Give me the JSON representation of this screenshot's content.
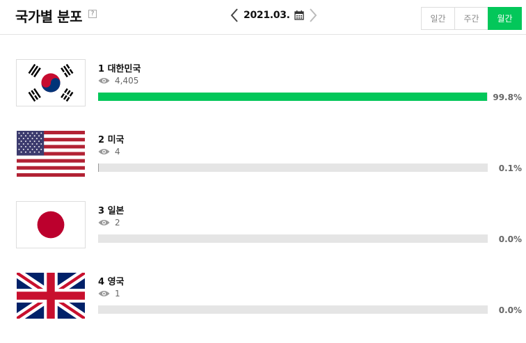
{
  "header": {
    "title": "국가별 분포",
    "help_label": "?",
    "date": "2021.03.",
    "period_tabs": [
      {
        "label": "일간",
        "active": false
      },
      {
        "label": "주간",
        "active": false
      },
      {
        "label": "월간",
        "active": true
      }
    ]
  },
  "colors": {
    "accent": "#03c75a",
    "track": "#e5e5e5",
    "secondary_bar": "#999999"
  },
  "countries": [
    {
      "rank_name": "1 대한민국",
      "views": "4,405",
      "percent_label": "99.8%",
      "share": 0.998,
      "flag_icon": "flag-korea-icon"
    },
    {
      "rank_name": "2 미국",
      "views": "4",
      "percent_label": "0.1%",
      "share": 0.001,
      "flag_icon": "flag-usa-icon"
    },
    {
      "rank_name": "3 일본",
      "views": "2",
      "percent_label": "0.0%",
      "share": 0.0,
      "flag_icon": "flag-japan-icon"
    },
    {
      "rank_name": "4 영국",
      "views": "1",
      "percent_label": "0.0%",
      "share": 0.0,
      "flag_icon": "flag-uk-icon"
    }
  ]
}
